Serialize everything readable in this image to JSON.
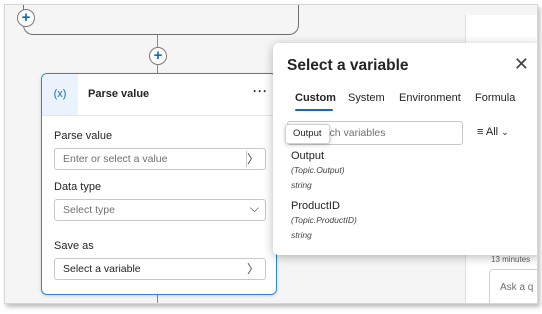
{
  "canvas": {
    "add_symbol": "+"
  },
  "node": {
    "icon_text": "(x)",
    "title": "Parse value",
    "more_symbol": "···",
    "parse_value": {
      "label": "Parse value",
      "placeholder": "Enter or select a value",
      "chevron": "〉"
    },
    "data_type": {
      "label": "Data type",
      "placeholder": "Select type",
      "chevron": "⌵"
    },
    "save_as": {
      "label": "Save as",
      "value": "Select a variable",
      "chevron": "〉"
    }
  },
  "panel": {
    "title": "Select a variable",
    "close_symbol": "✕",
    "tabs": [
      {
        "label": "Custom",
        "active": true
      },
      {
        "label": "System",
        "active": false
      },
      {
        "label": "Environment",
        "active": false
      },
      {
        "label": "Formula",
        "active": false
      }
    ],
    "search_placeholder": "rch variables",
    "filter_icon": "≡",
    "filter_label": "All",
    "filter_chevron": "⌄",
    "tooltip": "Output",
    "variables": [
      {
        "name": "Output",
        "path": "(Topic.Output)",
        "type": "string"
      },
      {
        "name": "ProductID",
        "path": "(Topic.ProductID)",
        "type": "string"
      }
    ]
  },
  "background": {
    "timestamp": "13 minutes",
    "ask_placeholder": "Ask a q"
  },
  "colors": {
    "accent": "#0f6cbd",
    "node_border": "#2b88d8"
  }
}
